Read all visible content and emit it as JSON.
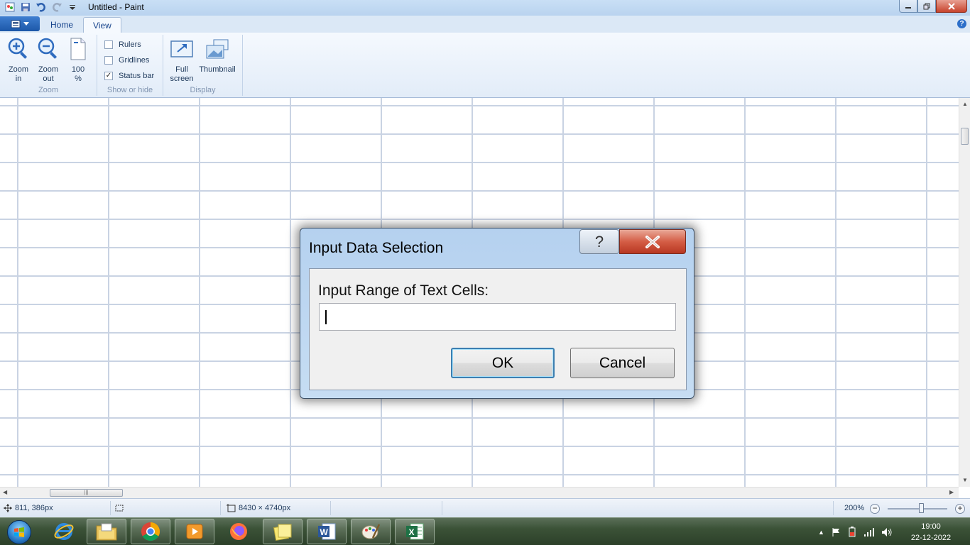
{
  "window": {
    "title": "Untitled - Paint"
  },
  "tabs": {
    "home": "Home",
    "view": "View"
  },
  "ribbon": {
    "zoom_in": [
      "Zoom",
      "in"
    ],
    "zoom_out": [
      "Zoom",
      "out"
    ],
    "zoom_100": [
      "100",
      "%"
    ],
    "zoom_group": "Zoom",
    "rulers": "Rulers",
    "gridlines": "Gridlines",
    "status_bar": "Status bar",
    "status_bar_checked": true,
    "rulers_checked": false,
    "gridlines_checked": false,
    "show_hide_group": "Show or hide",
    "full_screen": [
      "Full",
      "screen"
    ],
    "thumbnail": "Thumbnail",
    "display_group": "Display"
  },
  "status": {
    "cursor_pos": "811, 386px",
    "canvas_size": "8430 × 4740px",
    "zoom_level": "200%",
    "zoom_value_percent": 200
  },
  "dialog": {
    "title": "Input Data Selection",
    "help_glyph": "?",
    "label": "Input Range of Text Cells:",
    "input_value": "",
    "ok": "OK",
    "cancel": "Cancel"
  },
  "taskbar": {
    "apps": [
      "internet-explorer-icon",
      "file-explorer-icon",
      "chrome-icon",
      "media-player-icon",
      "firefox-icon",
      "sticky-notes-icon",
      "word-icon",
      "paint-icon",
      "excel-icon"
    ],
    "time": "19:00",
    "date": "22-12-2022"
  },
  "colors": {
    "accent": "#1c57a8",
    "close_red": "#c7432c",
    "grid": "#c9d3e3"
  }
}
